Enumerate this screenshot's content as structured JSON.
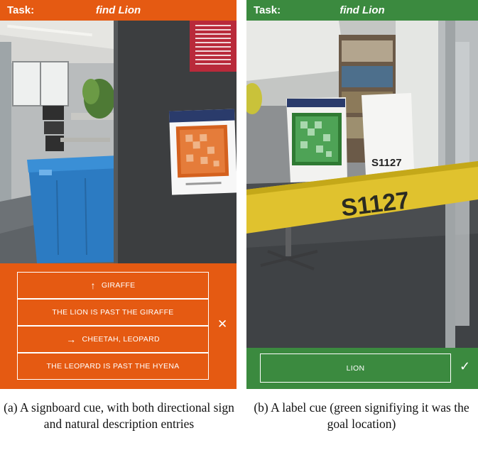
{
  "panel_a": {
    "task_label": "Task:",
    "task_value": "find Lion",
    "entries": [
      {
        "arrow": "↑",
        "text": "GIRAFFE"
      },
      {
        "arrow": "",
        "text": "THE LION IS PAST THE GIRAFFE"
      },
      {
        "arrow": "→",
        "text": "CHEETAH, LEOPARD"
      },
      {
        "arrow": "",
        "text": "THE LEOPARD IS PAST THE HYENA"
      }
    ],
    "close_glyph": "✕",
    "caption": "(a) A signboard cue, with both directional sign and natural description entries"
  },
  "panel_b": {
    "task_label": "Task:",
    "task_value": "find Lion",
    "label_text": "LION",
    "check_glyph": "✓",
    "door_sign_text": "S1127",
    "small_sign_text": "S1127",
    "caption": "(b) A label cue (green signifiying it was the goal location)"
  },
  "colors": {
    "orange": "#e55a12",
    "green": "#3b8a3f"
  }
}
